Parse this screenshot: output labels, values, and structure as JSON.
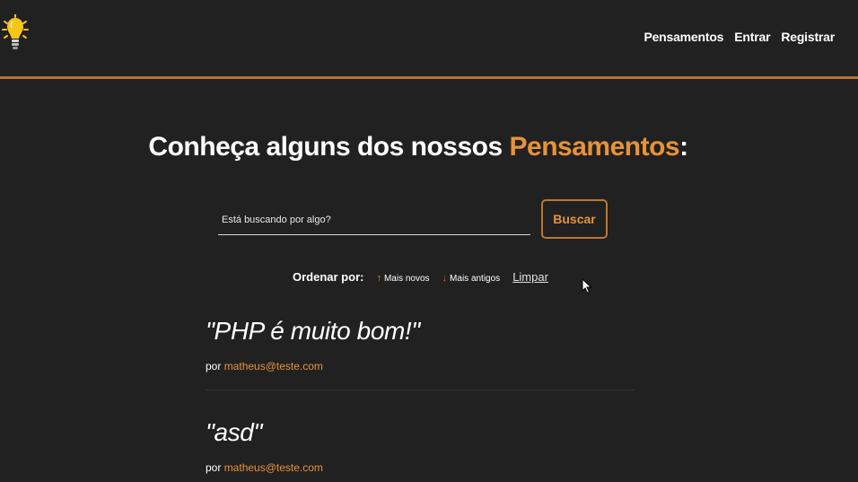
{
  "navbar": {
    "links": [
      "Pensamentos",
      "Entrar",
      "Registrar"
    ]
  },
  "main": {
    "title_prefix": "Conheça alguns dos nossos ",
    "title_accent": "Pensamentos",
    "title_suffix": ":",
    "search": {
      "placeholder": "Está buscando por algo?",
      "value": "",
      "button_label": "Buscar"
    },
    "order": {
      "label": "Ordenar por:",
      "newest_arrow": "↑",
      "newest_label": "Mais novos",
      "oldest_arrow": "↓",
      "oldest_label": "Mais antigos",
      "clear_label": "Limpar"
    },
    "thoughts": [
      {
        "text": "\"PHP é muito bom!\"",
        "author_prefix": "por ",
        "author": "matheus@teste.com"
      },
      {
        "text": "\"asd\"",
        "author_prefix": "por ",
        "author": "matheus@teste.com"
      }
    ]
  },
  "colors": {
    "background": "#212121",
    "accent": "#e8923a",
    "nav_border": "#b87333"
  },
  "icons": {
    "logo": "lightbulb-icon",
    "cursor": "mouse-pointer-icon"
  }
}
